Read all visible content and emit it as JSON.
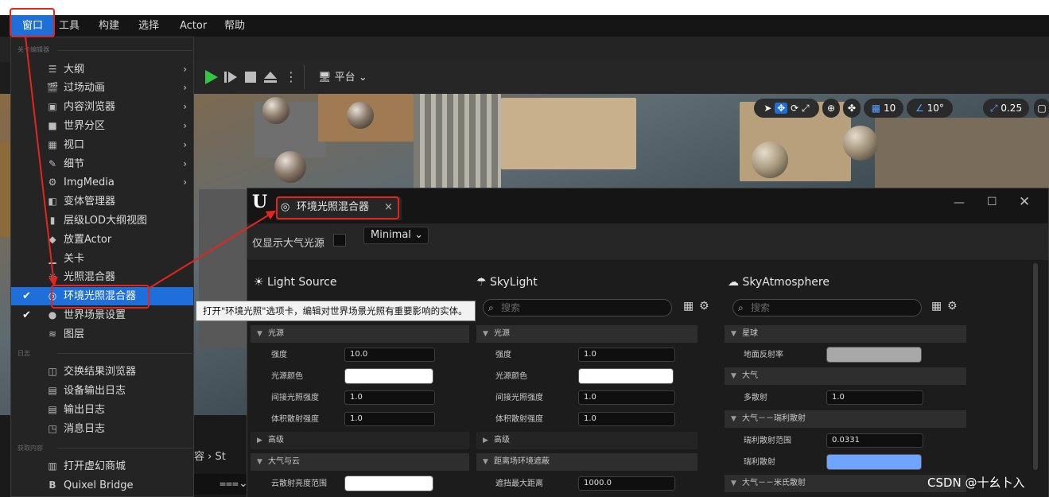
{
  "menubar": {
    "items": [
      "窗口",
      "工具",
      "构建",
      "选择",
      "Actor",
      "帮助"
    ]
  },
  "toolbar": {
    "platform_label": "平台"
  },
  "viewport": {
    "grid_value": "10",
    "angle_value": "10°",
    "scale_value": "0.25"
  },
  "window_menu": {
    "section_level_editor": "关卡编辑器",
    "section_log": "日志",
    "section_get_content": "获取内容",
    "items": [
      {
        "label": "大纲",
        "icon": "outliner-icon",
        "submenu": true
      },
      {
        "label": "过场动画",
        "icon": "clapper-icon",
        "submenu": true
      },
      {
        "label": "内容浏览器",
        "icon": "content-browser-icon",
        "submenu": true
      },
      {
        "label": "世界分区",
        "icon": "world-partition-icon",
        "submenu": true
      },
      {
        "label": "视口",
        "icon": "viewport-icon",
        "submenu": true
      },
      {
        "label": "细节",
        "icon": "details-icon",
        "submenu": true
      },
      {
        "label": "ImgMedia",
        "icon": "imgmedia-icon",
        "submenu": true
      },
      {
        "label": "变体管理器",
        "icon": "variant-manager-icon"
      },
      {
        "label": "层级LOD大纲视图",
        "icon": "hlod-icon"
      },
      {
        "label": "放置Actor",
        "icon": "place-actor-icon"
      },
      {
        "label": "关卡",
        "icon": "level-icon"
      },
      {
        "label": "光照混合器",
        "icon": "light-mixer-icon"
      },
      {
        "label": "环境光照混合器",
        "icon": "env-light-mixer-icon",
        "checked": true,
        "active": true
      },
      {
        "label": "世界场景设置",
        "icon": "world-settings-icon",
        "checked": true
      },
      {
        "label": "图层",
        "icon": "layers-icon"
      }
    ],
    "log_items": [
      {
        "label": "交换结果浏览器",
        "icon": "interchange-icon"
      },
      {
        "label": "设备输出日志",
        "icon": "device-log-icon"
      },
      {
        "label": "输出日志",
        "icon": "output-log-icon"
      },
      {
        "label": "消息日志",
        "icon": "message-log-icon"
      }
    ],
    "content_items": [
      {
        "label": "打开虚幻商城",
        "icon": "marketplace-icon"
      },
      {
        "label": "Quixel Bridge",
        "icon": "bridge-icon"
      }
    ]
  },
  "tooltip": {
    "text": "打开\"环境光照\"选项卡，编辑对世界场景光照有重要影响的实体。"
  },
  "env_window": {
    "tab_title": "环境光照混合器",
    "only_atmosphere_label": "仅显示大气光源",
    "mode_value": "Minimal",
    "search_placeholder": "搜索",
    "columns": [
      {
        "title": "Light Source",
        "categories": [
          {
            "name": "光源",
            "expanded": true,
            "rows": [
              {
                "label": "强度",
                "value": "10.0"
              },
              {
                "label": "光源颜色",
                "color": "#ffffff"
              },
              {
                "label": "间接光照强度",
                "value": "1.0"
              },
              {
                "label": "体积散射强度",
                "value": "1.0"
              }
            ]
          },
          {
            "name": "高级",
            "expanded": false,
            "rows": []
          },
          {
            "name": "大气与云",
            "expanded": true,
            "rows": [
              {
                "label": "云散射亮度范围",
                "color": "#ffffff"
              }
            ]
          }
        ]
      },
      {
        "title": "SkyLight",
        "categories": [
          {
            "name": "光源",
            "expanded": true,
            "rows": [
              {
                "label": "强度",
                "value": "1.0"
              },
              {
                "label": "光源颜色",
                "color": "#ffffff"
              },
              {
                "label": "间接光照强度",
                "value": "1.0"
              },
              {
                "label": "体积散射强度",
                "value": "1.0"
              }
            ]
          },
          {
            "name": "高级",
            "expanded": false,
            "rows": []
          },
          {
            "name": "距离场环境遮蔽",
            "expanded": true,
            "rows": [
              {
                "label": "遮挡最大距离",
                "value": "1000.0"
              }
            ]
          }
        ]
      },
      {
        "title": "SkyAtmosphere",
        "categories": [
          {
            "name": "星球",
            "expanded": true,
            "rows": [
              {
                "label": "地面反射率",
                "color": "#a8a8a8"
              }
            ]
          },
          {
            "name": "大气",
            "expanded": true,
            "rows": [
              {
                "label": "多散射",
                "value": "1.0"
              }
            ]
          },
          {
            "name": "大气－－瑞利散射",
            "expanded": true,
            "rows": [
              {
                "label": "瑞利散射范围",
                "value": "0.0331"
              },
              {
                "label": "瑞利散射",
                "color": "#6fa4ff"
              }
            ]
          },
          {
            "name": "大气－－米氏散射",
            "expanded": true,
            "rows": []
          }
        ]
      }
    ]
  },
  "bottom": {
    "breadcrumb_text": "容 › St"
  },
  "watermark": "CSDN @十幺卜入",
  "colors": {
    "accent": "#1e6fd9",
    "annotation": "#e3261d"
  }
}
